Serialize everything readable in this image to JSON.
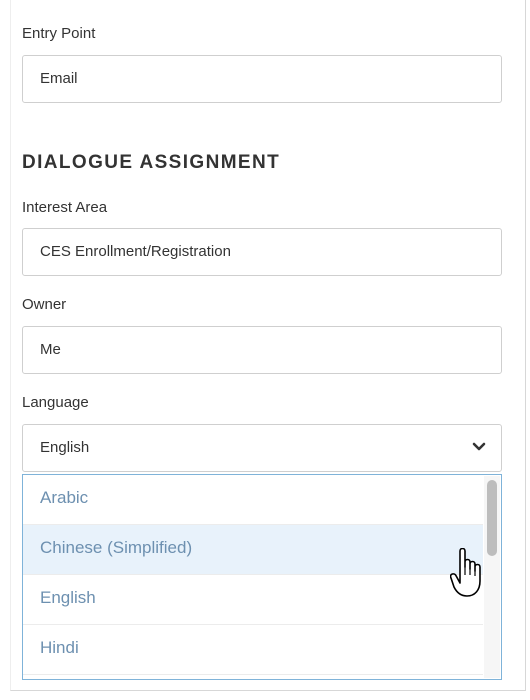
{
  "entry_point": {
    "label": "Entry Point",
    "value": "Email"
  },
  "section": {
    "title": "DIALOGUE ASSIGNMENT"
  },
  "interest_area": {
    "label": "Interest Area",
    "value": "CES Enrollment/Registration"
  },
  "owner": {
    "label": "Owner",
    "value": "Me"
  },
  "language": {
    "label": "Language",
    "selected": "English",
    "options": [
      "Arabic",
      "Chinese (Simplified)",
      "English",
      "Hindi"
    ],
    "hovered_option": "Chinese (Simplified)"
  },
  "colors": {
    "dropdown_border": "#7fb3d9",
    "option_text": "#6d90b0",
    "hover_bg": "#e8f2fb"
  },
  "icons": {
    "chevron": "chevron-down-icon",
    "cursor": "hand-pointer-icon"
  }
}
